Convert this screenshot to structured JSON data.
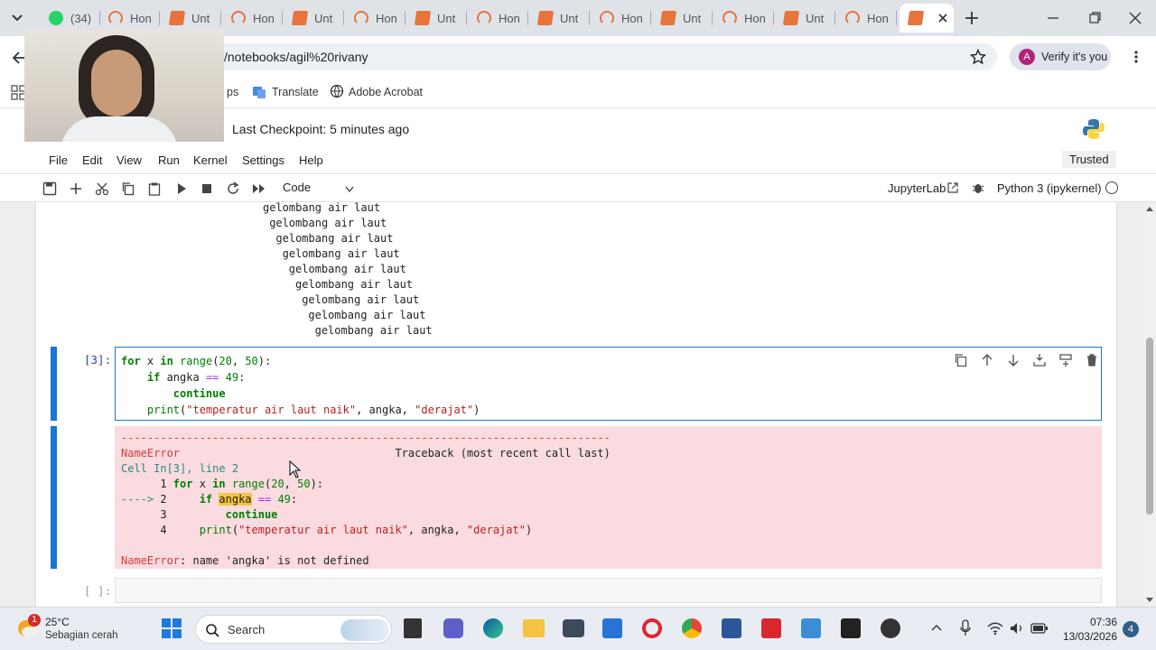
{
  "browser": {
    "tabs": [
      {
        "label": "(34)",
        "icon": "whatsapp-icon"
      },
      {
        "label": "Hon",
        "icon": "jupyter-home-icon"
      },
      {
        "label": "Unt",
        "icon": "notebook-icon"
      },
      {
        "label": "Hon",
        "icon": "jupyter-home-icon"
      },
      {
        "label": "Unt",
        "icon": "notebook-icon"
      },
      {
        "label": "Hon",
        "icon": "jupyter-home-icon"
      },
      {
        "label": "Unt",
        "icon": "notebook-icon"
      },
      {
        "label": "Hon",
        "icon": "jupyter-home-icon"
      },
      {
        "label": "Unt",
        "icon": "notebook-icon"
      },
      {
        "label": "Hon",
        "icon": "jupyter-home-icon"
      },
      {
        "label": "Unt",
        "icon": "notebook-icon"
      },
      {
        "label": "Hon",
        "icon": "jupyter-home-icon"
      },
      {
        "label": "Unt",
        "icon": "notebook-icon"
      },
      {
        "label": "Hon",
        "icon": "jupyter-home-icon"
      }
    ],
    "url": "/notebooks/agil%20rivany",
    "verify_label": "Verify it's you",
    "avatar_letter": "A",
    "bookmarks": [
      {
        "label": "ps",
        "icon": "apps-icon"
      },
      {
        "label": "Translate",
        "icon": "translate-icon"
      },
      {
        "label": "Adobe Acrobat",
        "icon": "acrobat-icon"
      }
    ]
  },
  "jupyter": {
    "checkpoint": "Last Checkpoint: 5 minutes ago",
    "menu": [
      "File",
      "Edit",
      "View",
      "Run",
      "Kernel",
      "Settings",
      "Help"
    ],
    "trusted": "Trusted",
    "cell_type": "Code",
    "jupyterlab_label": "JupyterLab",
    "kernel": "Python 3 (ipykernel)"
  },
  "output_lines": [
    "gelombang air laut",
    "gelombang air laut",
    "gelombang air laut",
    "gelombang air laut",
    "gelombang air laut",
    "gelombang air laut",
    "gelombang air laut",
    "gelombang air laut",
    "gelombang air laut"
  ],
  "cell": {
    "prompt": "[3]:",
    "empty_prompt": "[ ]:"
  },
  "error": {
    "dashes": "---------------------------------------------------------------------------",
    "name": "NameError",
    "traceback": "Traceback (most recent call last)",
    "cell_ref": "Cell In[3], line 2",
    "arrow": "---->",
    "final_msg": ": name 'angka' is not defined"
  },
  "taskbar": {
    "temp": "25°C",
    "weather": "Sebagian cerah",
    "weather_badge": "1",
    "search": "Search",
    "time": "07:36",
    "date": "13/03/2026",
    "notif_count": "4"
  },
  "colors": {
    "error_bg": "#fadbdf",
    "cell_bar": "#1976d2",
    "accent_orange": "#e8743b"
  }
}
